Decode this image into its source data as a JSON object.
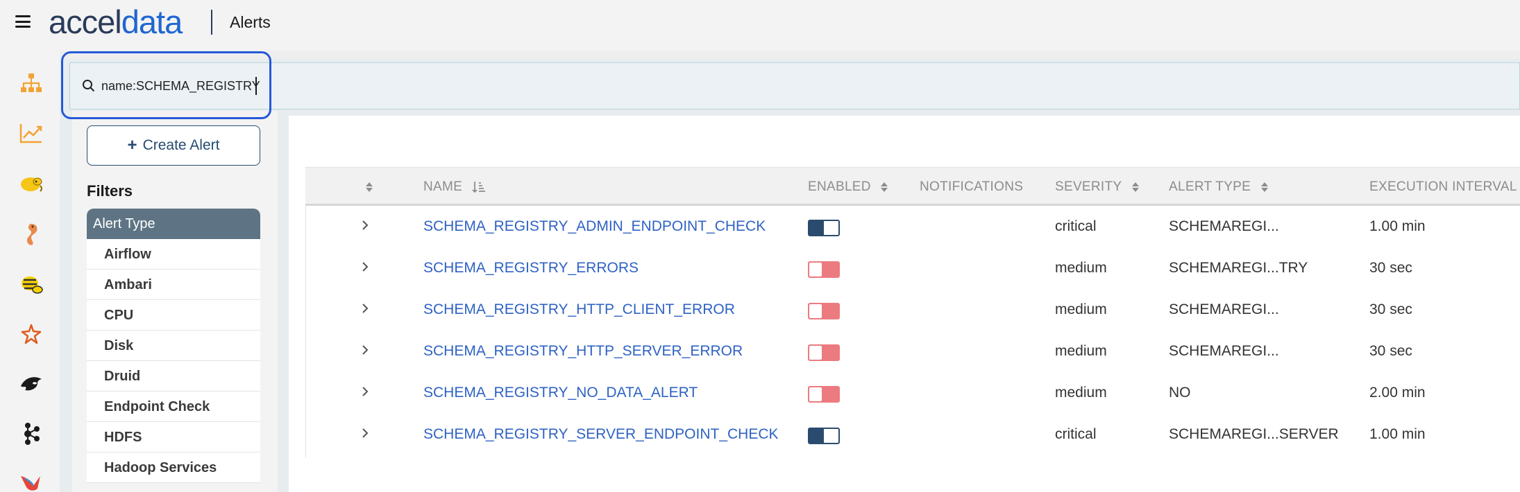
{
  "app": {
    "logo_part1": "accel",
    "logo_part2": "data",
    "page_title": "Alerts"
  },
  "search": {
    "value": "name:SCHEMA_REGISTRY"
  },
  "sidebar": {
    "create_alert_label": "Create Alert",
    "filters_title": "Filters",
    "filter_group_title": "Alert Type",
    "filter_items": [
      "Airflow",
      "Ambari",
      "CPU",
      "Disk",
      "Druid",
      "Endpoint Check",
      "HDFS",
      "Hadoop Services"
    ]
  },
  "rail_icons": [
    "hierarchy-icon",
    "chart-line-icon",
    "hadoop-elephant-icon",
    "seahorse-icon",
    "hive-bee-icon",
    "spark-star-icon",
    "orca-icon",
    "kafka-icon",
    "bird-icon"
  ],
  "table": {
    "headers": {
      "name": "NAME",
      "enabled": "ENABLED",
      "notifications": "NOTIFICATIONS",
      "severity": "SEVERITY",
      "alert_type": "ALERT TYPE",
      "execution_interval": "EXECUTION INTERVAL"
    },
    "rows": [
      {
        "name": "SCHEMA_REGISTRY_ADMIN_ENDPOINT_CHECK",
        "enabled": true,
        "severity": "critical",
        "alert_type": "SCHEMAREGI...",
        "interval": "1.00 min"
      },
      {
        "name": "SCHEMA_REGISTRY_ERRORS",
        "enabled": false,
        "severity": "medium",
        "alert_type": "SCHEMAREGI...TRY",
        "interval": "30 sec"
      },
      {
        "name": "SCHEMA_REGISTRY_HTTP_CLIENT_ERROR",
        "enabled": false,
        "severity": "medium",
        "alert_type": "SCHEMAREGI...",
        "interval": "30 sec"
      },
      {
        "name": "SCHEMA_REGISTRY_HTTP_SERVER_ERROR",
        "enabled": false,
        "severity": "medium",
        "alert_type": "SCHEMAREGI...",
        "interval": "30 sec"
      },
      {
        "name": "SCHEMA_REGISTRY_NO_DATA_ALERT",
        "enabled": false,
        "severity": "medium",
        "alert_type": "NO",
        "interval": "2.00 min"
      },
      {
        "name": "SCHEMA_REGISTRY_SERVER_ENDPOINT_CHECK",
        "enabled": true,
        "severity": "critical",
        "alert_type": "SCHEMAREGI...SERVER",
        "interval": "1.00 min"
      }
    ]
  },
  "colors": {
    "link": "#2e62c4",
    "toggle_on": "#2a4b6e",
    "toggle_off": "#ec7b80",
    "focus_ring": "#2659d6",
    "filter_header": "#5e7484"
  }
}
